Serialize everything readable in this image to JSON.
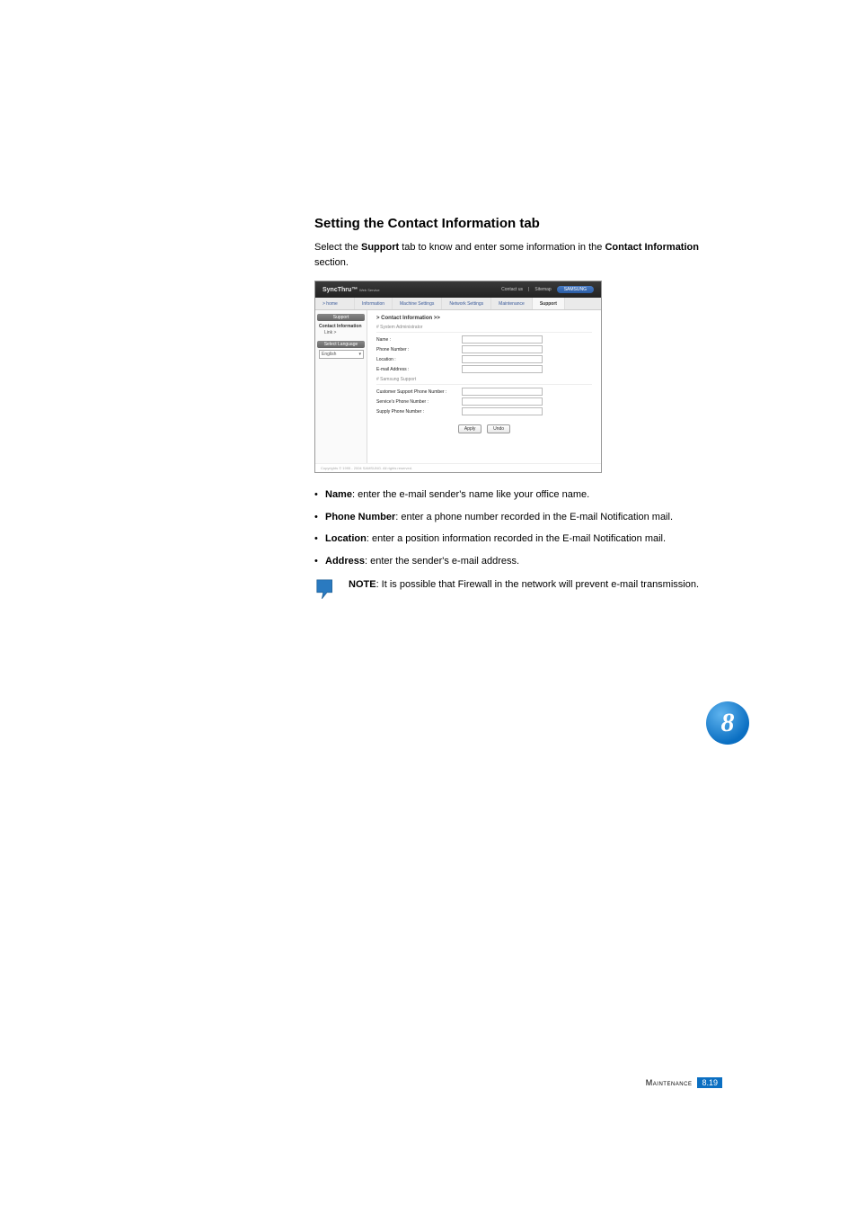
{
  "heading": "Setting the Contact Information tab",
  "intro_parts": {
    "pre": "Select the ",
    "b1": "Support",
    "mid": " tab to know and enter some information in the ",
    "b2": "Contact Information",
    "post": " section."
  },
  "screenshot": {
    "logo": "SyncThru™",
    "logo_sub": "Web Service",
    "top_links": {
      "contact": "Contact us",
      "sitemap": "Sitemap",
      "brand": "SAMSUNG"
    },
    "tabs": {
      "home": "> home",
      "info": "Information",
      "machine": "Machine Settings",
      "network": "Network Settings",
      "maint": "Maintenance",
      "support": "Support"
    },
    "sidebar": {
      "header1": "Support",
      "item1": "Contact Information",
      "item1_sub": "Link >",
      "header2": "Select Language",
      "lang_value": "English"
    },
    "main": {
      "title": "> Contact Information >>",
      "section1": "# System Administrator",
      "f_name": "Name :",
      "f_phone": "Phone Number :",
      "f_location": "Location :",
      "f_email": "E-mail Address :",
      "section2": "# Samsung Support",
      "f_cust": "Customer Support Phone Number :",
      "f_service": "Service's Phone Number :",
      "f_supply": "Supply Phone Number :",
      "btn_apply": "Apply",
      "btn_undo": "Undo",
      "copyright": "Copyrights © 1995 - 2004 SAMSUNG. All rights reserved."
    }
  },
  "bullets": [
    {
      "bold": "Name",
      "rest": ": enter the e-mail sender's name like your office name."
    },
    {
      "bold": "Phone Number",
      "rest": ": enter a phone number recorded in the E-mail Notification mail."
    },
    {
      "bold": "Location",
      "rest": ": enter a position information recorded in the E-mail Notification mail."
    },
    {
      "bold": "Address",
      "rest": ": enter the sender's e-mail address."
    }
  ],
  "note": {
    "bold": "NOTE",
    "rest": ": It is possible that Firewall in the network will prevent e-mail transmission."
  },
  "chapter": "8",
  "footer": {
    "label": "Maintenance",
    "page": "8.19"
  }
}
